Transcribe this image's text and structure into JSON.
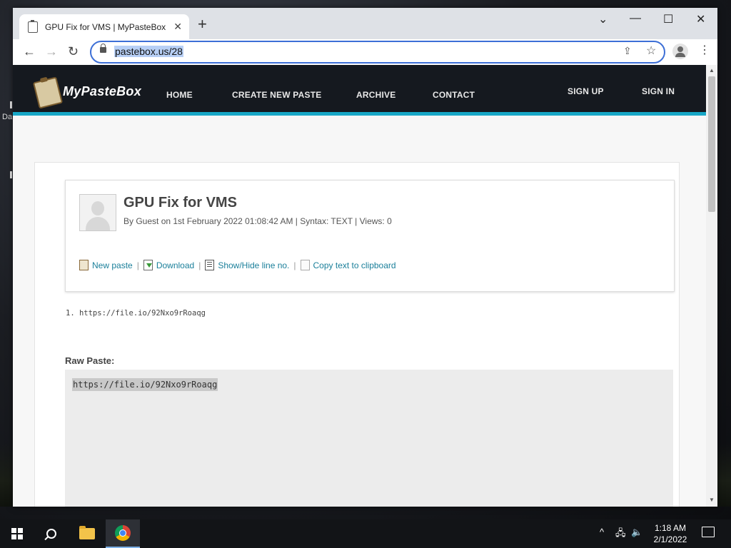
{
  "desktop": {
    "label": "Da"
  },
  "browser": {
    "tab_title": "GPU Fix for VMS | MyPasteBox - ",
    "tab_close": "✕",
    "new_tab": "+",
    "controls": {
      "dropdown": "⌄",
      "minimize": "—",
      "maximize": "☐",
      "close": "✕"
    },
    "nav": {
      "back": "←",
      "forward": "→",
      "reload": "↻"
    },
    "url": "pastebox.us/28",
    "share_icon": "⇪",
    "star_icon": "☆",
    "menu": "⋮"
  },
  "site": {
    "logo_text": "MyPasteBox",
    "nav_items": [
      "HOME",
      "CREATE NEW PASTE",
      "ARCHIVE",
      "CONTACT"
    ],
    "auth_items": [
      "SIGN UP",
      "SIGN IN"
    ]
  },
  "paste": {
    "title": "GPU Fix for VMS",
    "meta": "By Guest on 1st February 2022 01:08:42 AM | Syntax: TEXT | Views: 0",
    "actions": [
      "New paste",
      "Download",
      "Show/Hide line no.",
      "Copy text to clipboard"
    ],
    "separator": "|",
    "code_lines": [
      "1. https://file.io/92Nxo9rRoaqg"
    ],
    "raw_label": "Raw Paste:",
    "raw_text": "https://file.io/92Nxo9rRoaqg"
  },
  "taskbar": {
    "clock_time": "1:18 AM",
    "clock_date": "2/1/2022",
    "tray_chevron": "^",
    "tray_network": "🖧",
    "tray_volume": "🔈"
  },
  "colors": {
    "accent": "#17a7c6",
    "nav_bg": "#15191f",
    "link": "#1a7f9a"
  }
}
